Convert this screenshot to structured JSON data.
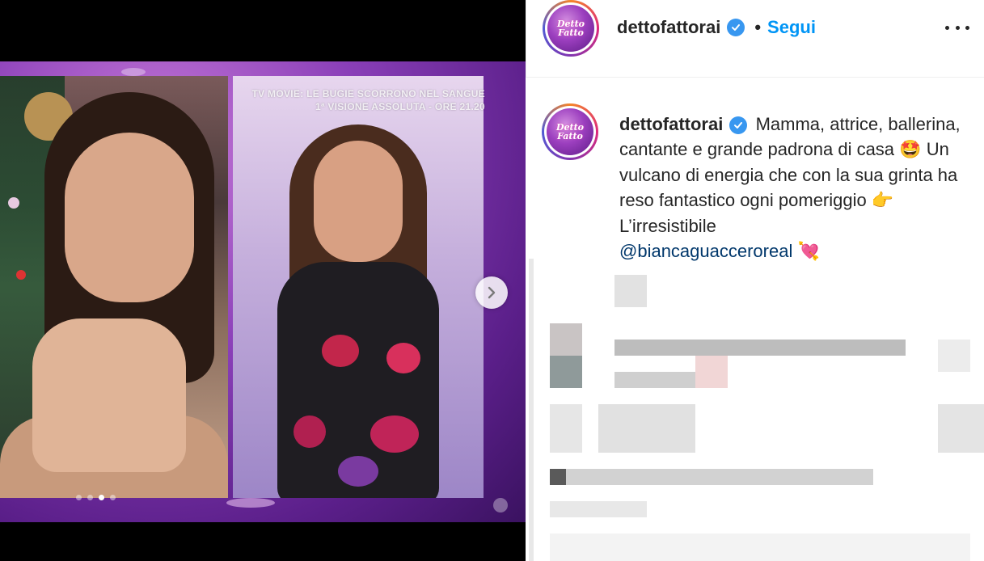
{
  "media": {
    "tv_banner_line1": "TV MOVIE: LE BUGIE SCORRONO NEL SANGUE",
    "tv_banner_line2": "1ª VISIONE ASSOLUTA - ORE 21.20",
    "carousel_dots": 4,
    "active_dot": 3,
    "next_icon": "chevron-right-icon"
  },
  "header": {
    "avatar_text_line1": "Detto",
    "avatar_text_line2": "Fatto",
    "username": "dettofattorai",
    "verified_icon": "verified-badge-icon",
    "separator": "•",
    "follow_label": "Segui",
    "more_icon": "more-options-icon"
  },
  "caption": {
    "username": "dettofattorai",
    "text_part1": "Mamma, attrice, ballerina, cantante e grande padrona di casa",
    "emoji1": "🤩",
    "text_part2": "Un vulcano di energia che con la sua grinta ha reso fantastico ogni pomeriggio",
    "emoji2": "👉",
    "text_part3": "L’irresistibile",
    "mention": "@biancaguacceroreal",
    "emoji3": "💘"
  },
  "colors": {
    "link_blue": "#0095f6",
    "mention_blue": "#00376b",
    "verified_blue": "#3897f0",
    "text": "#262626"
  }
}
